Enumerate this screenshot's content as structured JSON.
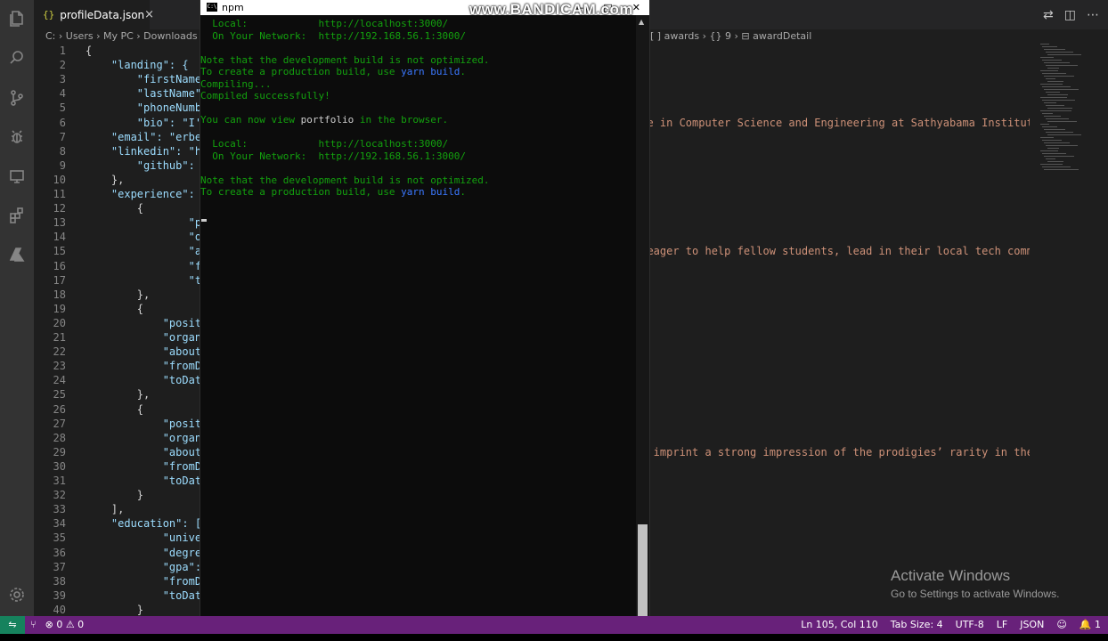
{
  "tab": {
    "icon": "{}",
    "title": "profileData.json",
    "close": "×"
  },
  "tab_actions": [
    "⇄",
    "◫",
    "⋯"
  ],
  "breadcrumb": {
    "left": "C: › Users › My PC › Downloads ›",
    "right": "[ ] awards › {} 9 › ⊟ awardDetail"
  },
  "code_lines": [
    {
      "n": "1",
      "t": "{"
    },
    {
      "n": "2",
      "t": "    \"landing\": {"
    },
    {
      "n": "3",
      "t": "        \"firstName\":"
    },
    {
      "n": "4",
      "t": "        \"lastName\":"
    },
    {
      "n": "5",
      "t": "        \"phoneNumber"
    },
    {
      "n": "6",
      "t": "        \"bio\": \"I'm"
    },
    {
      "n": "7",
      "t": "    \"email\": \"erbeus"
    },
    {
      "n": "8",
      "t": "    \"linkedin\": \"htt"
    },
    {
      "n": "9",
      "t": "        \"github\": \"h"
    },
    {
      "n": "10",
      "t": "    },"
    },
    {
      "n": "11",
      "t": "    \"experience\": ["
    },
    {
      "n": "12",
      "t": "        {"
    },
    {
      "n": "13",
      "t": "                \"pos"
    },
    {
      "n": "14",
      "t": "                \"org"
    },
    {
      "n": "15",
      "t": "                \"abo"
    },
    {
      "n": "16",
      "t": "                \"fro"
    },
    {
      "n": "17",
      "t": "                \"toD"
    },
    {
      "n": "18",
      "t": "        },"
    },
    {
      "n": "19",
      "t": "        {"
    },
    {
      "n": "20",
      "t": "            \"positio"
    },
    {
      "n": "21",
      "t": "            \"organiz"
    },
    {
      "n": "22",
      "t": "            \"aboutWo"
    },
    {
      "n": "23",
      "t": "            \"fromDat"
    },
    {
      "n": "24",
      "t": "            \"toDate\""
    },
    {
      "n": "25",
      "t": "        },"
    },
    {
      "n": "26",
      "t": "        {"
    },
    {
      "n": "27",
      "t": "            \"positio"
    },
    {
      "n": "28",
      "t": "            \"organiz"
    },
    {
      "n": "29",
      "t": "            \"aboutWo"
    },
    {
      "n": "30",
      "t": "            \"fromDat"
    },
    {
      "n": "31",
      "t": "            \"toDate\""
    },
    {
      "n": "32",
      "t": "        }"
    },
    {
      "n": "33",
      "t": "    ],"
    },
    {
      "n": "34",
      "t": "    \"education\": [{"
    },
    {
      "n": "35",
      "t": "            \"univers"
    },
    {
      "n": "36",
      "t": "            \"degree\""
    },
    {
      "n": "37",
      "t": "            \"gpa\": '"
    },
    {
      "n": "38",
      "t": "            \"fromDat"
    },
    {
      "n": "39",
      "t": "            \"toDate\""
    },
    {
      "n": "40",
      "t": "        }"
    }
  ],
  "right_text": {
    "line7": "rse in Computer Science and Engineering at Sathyabama Institute of",
    "line16": "e eager to help fellow students, lead in their local tech communit",
    "line30": " to imprint a strong impression of the prodigies’ rarity in the so"
  },
  "terminal": {
    "title": "npm",
    "watermark": "www.BANDICAM.com",
    "buttons": [
      "—",
      "□",
      "✕"
    ],
    "lines": [
      {
        "pre": "  Local:            http://localhost:3000/",
        "c": "",
        "post": ""
      },
      {
        "pre": "  On Your Network:  http://192.168.56.1:3000/",
        "c": "",
        "post": ""
      },
      {
        "pre": "",
        "c": "",
        "post": ""
      },
      {
        "pre": "Note that the development build is not optimized.",
        "c": "",
        "post": ""
      },
      {
        "pre": "To create a production build, use ",
        "c": "yarn build",
        "post": "."
      },
      {
        "pre": "Compiling...",
        "c": "",
        "post": ""
      },
      {
        "pre": "Compiled successfully!",
        "c": "",
        "post": ""
      },
      {
        "pre": "",
        "c": "",
        "post": ""
      },
      {
        "pre": "You can now view ",
        "c": "",
        "post": "",
        "w": "portfolio",
        "tail": " in the browser."
      },
      {
        "pre": "",
        "c": "",
        "post": ""
      },
      {
        "pre": "  Local:            http://localhost:3000/",
        "c": "",
        "post": ""
      },
      {
        "pre": "  On Your Network:  http://192.168.56.1:3000/",
        "c": "",
        "post": ""
      },
      {
        "pre": "",
        "c": "",
        "post": ""
      },
      {
        "pre": "Note that the development build is not optimized.",
        "c": "",
        "post": ""
      },
      {
        "pre": "To create a production build, use ",
        "c": "yarn build",
        "post": "."
      }
    ]
  },
  "activate": {
    "title": "Activate Windows",
    "sub": "Go to Settings to activate Windows."
  },
  "status": {
    "remote": "⇋",
    "branch": "⑂",
    "problems": "⊗ 0 ⚠ 0",
    "position": "Ln 105, Col 110",
    "tabsize": "Tab Size: 4",
    "encoding": "UTF-8",
    "eol": "LF",
    "language": "JSON",
    "feedback": "☺",
    "notifications": "🔔 1"
  }
}
